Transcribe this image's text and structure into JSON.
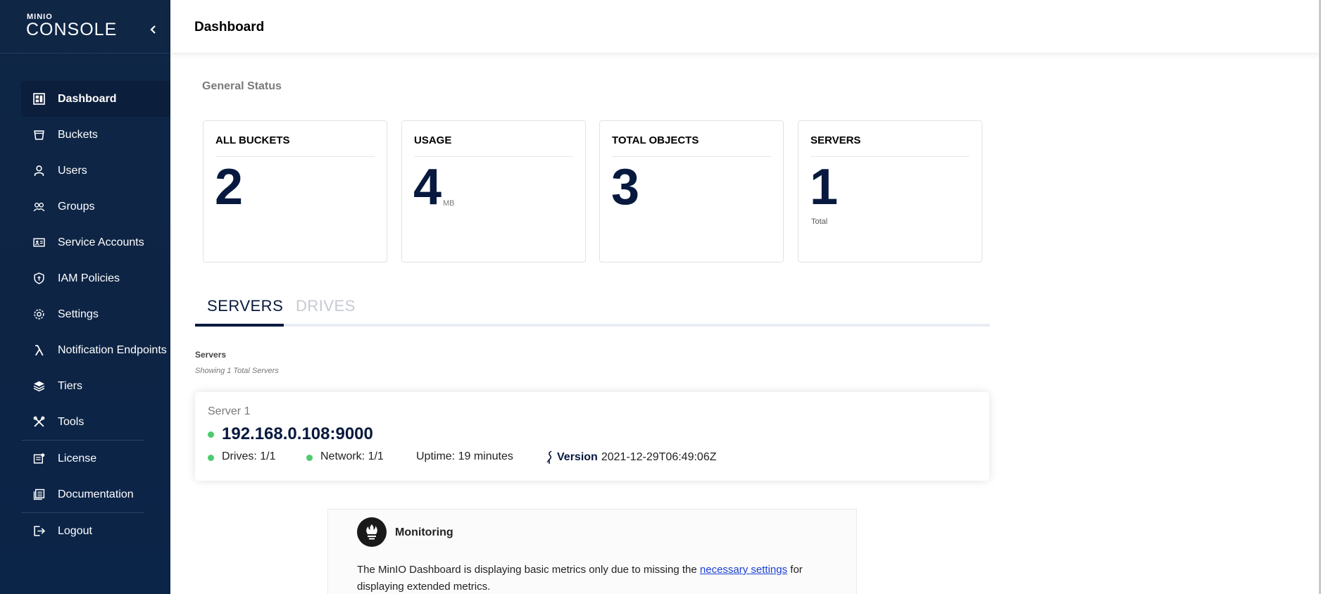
{
  "sidebar": {
    "logo_small": "MINIO",
    "logo_big": "CONSOLE",
    "items": [
      {
        "label": "Dashboard",
        "icon": "dashboard-icon",
        "active": true
      },
      {
        "label": "Buckets",
        "icon": "bucket-icon"
      },
      {
        "label": "Users",
        "icon": "user-icon"
      },
      {
        "label": "Groups",
        "icon": "groups-icon"
      },
      {
        "label": "Service Accounts",
        "icon": "id-card-icon"
      },
      {
        "label": "IAM Policies",
        "icon": "shield-icon"
      },
      {
        "label": "Settings",
        "icon": "gear-icon"
      },
      {
        "label": "Notification Endpoints",
        "icon": "lambda-icon"
      },
      {
        "label": "Tiers",
        "icon": "layers-icon"
      },
      {
        "label": "Tools",
        "icon": "tools-icon"
      },
      {
        "label": "License",
        "icon": "license-icon"
      },
      {
        "label": "Documentation",
        "icon": "documentation-icon"
      },
      {
        "label": "Logout",
        "icon": "logout-icon"
      }
    ]
  },
  "header": {
    "title": "Dashboard"
  },
  "general_status": {
    "title": "General Status",
    "cards": [
      {
        "title": "ALL BUCKETS",
        "value": "2"
      },
      {
        "title": "USAGE",
        "value": "4",
        "unit": "MB"
      },
      {
        "title": "TOTAL OBJECTS",
        "value": "3"
      },
      {
        "title": "SERVERS",
        "value": "1",
        "sub": "Total"
      }
    ]
  },
  "tabs": [
    {
      "label": "SERVERS",
      "active": true
    },
    {
      "label": "DRIVES",
      "active": false
    }
  ],
  "servers": {
    "label": "Servers",
    "subtitle": "Showing 1 Total Servers",
    "list": [
      {
        "name": "Server 1",
        "address": "192.168.0.108:9000",
        "drives": "Drives: 1/1",
        "network": "Network: 1/1",
        "uptime": "Uptime: 19 minutes",
        "version_label": "Version",
        "version": "2021-12-29T06:49:06Z"
      }
    ]
  },
  "monitoring": {
    "title": "Monitoring",
    "text_before": "The MinIO Dashboard is displaying basic metrics only due to missing the ",
    "link": "necessary settings",
    "text_after": " for displaying extended metrics."
  },
  "colors": {
    "sidebar_bg": "#0f2645",
    "accent": "#07193e",
    "status_ok": "#4ccb6f",
    "link": "#1a3fd6"
  }
}
